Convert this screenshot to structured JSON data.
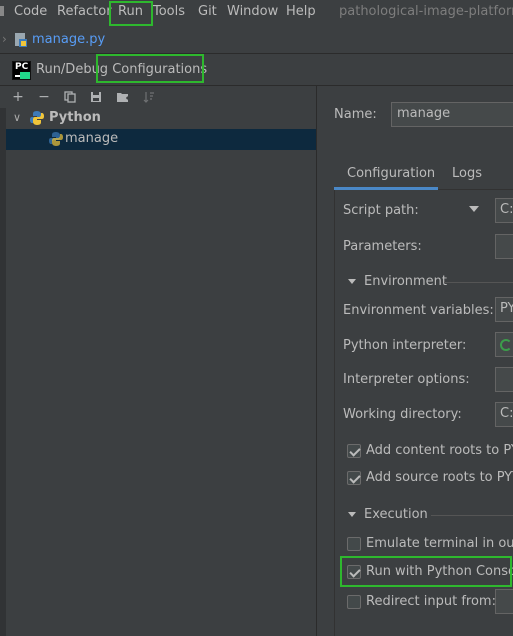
{
  "menubar": {
    "items": [
      "Code",
      "Refactor",
      "Run",
      "Tools",
      "Git",
      "Window",
      "Help"
    ],
    "project_name": "pathological-image-platform"
  },
  "tabbar": {
    "file_name": "manage.py"
  },
  "dialog": {
    "title": "Run/Debug Configurations"
  },
  "left": {
    "tree": [
      {
        "label": "Python",
        "kind": "group"
      },
      {
        "label": "manage",
        "kind": "config"
      }
    ]
  },
  "right": {
    "name_label": "Name:",
    "name_value": "manage",
    "tabs": [
      "Configuration",
      "Logs"
    ],
    "fields": {
      "script_path": {
        "label": "Script path:",
        "value": "C:"
      },
      "parameters": {
        "label": "Parameters:",
        "value": ""
      },
      "environment_section": "Environment",
      "env_vars": {
        "label": "Environment variables:",
        "value": "PY"
      },
      "python_interpreter": {
        "label": "Python interpreter:",
        "value": ""
      },
      "interpreter_options": {
        "label": "Interpreter options:",
        "value": ""
      },
      "working_directory": {
        "label": "Working directory:",
        "value": "C:"
      },
      "content_roots": {
        "label": "Add content roots to PYT",
        "checked": true
      },
      "source_roots": {
        "label": "Add source roots to PYTH",
        "checked": true
      },
      "execution_section": "Execution",
      "emulate_terminal": {
        "label": "Emulate terminal in outpu",
        "checked": false
      },
      "run_console": {
        "label": "Run with Python Console",
        "checked": true
      },
      "redirect_input": {
        "label": "Redirect input from:",
        "checked": false
      }
    }
  },
  "colors": {
    "background": "#3c3f41",
    "selection": "#0d293e",
    "link": "#589df6",
    "highlight": "#2eb82e"
  }
}
